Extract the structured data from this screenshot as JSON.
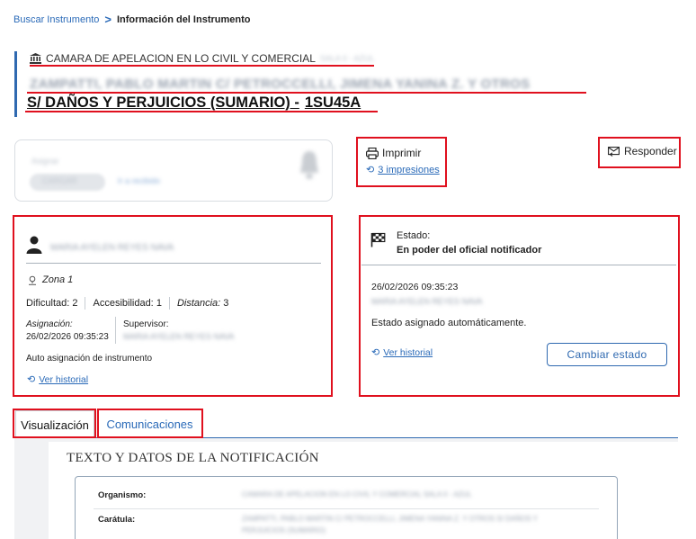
{
  "breadcrumb": {
    "link": "Buscar Instrumento",
    "separator": ">",
    "current": "Información del Instrumento"
  },
  "header": {
    "court": "CAMARA DE APELACION EN LO CIVIL Y COMERCIAL",
    "court_suffix_redacted": "SALA II - AZUL",
    "parties_redacted": "ZAMPATTI, PABLO MARTIN C/ PETROCCELLI, JIMENA YANINA Z. Y OTROS",
    "caption": "S/ DAÑOS Y PERJUICIOS (SUMARIO) -",
    "case_number": "1SU45A"
  },
  "blurred_card": {
    "label": "Asignar",
    "pill": "CARGAR",
    "link": "Ir a recibido"
  },
  "print": {
    "label": "Imprimir",
    "prints_link": "3 impresiones"
  },
  "reply": {
    "label": "Responder"
  },
  "assignment": {
    "person_redacted": "MARIA AYELEN REYES NAVA",
    "zone": "Zona 1",
    "difficulty_label": "Dificultad:",
    "difficulty": "2",
    "accessibility_label": "Accesibilidad:",
    "accessibility": "1",
    "distance_label": "Distancia:",
    "distance": "3",
    "assigned_label": "Asignación:",
    "assigned_date": "26/02/2026 09:35:23",
    "supervisor_label": "Supervisor:",
    "supervisor_redacted": "MARIA AYELEN REYES NAVA",
    "auto_note": "Auto asignación de instrumento",
    "history_link": "Ver historial"
  },
  "status": {
    "label": "Estado:",
    "value": "En poder del oficial notificador",
    "date": "26/02/2026 09:35:23",
    "user_redacted": "MARIA AYELEN REYES NAVA",
    "note": "Estado asignado automáticamente.",
    "history_link": "Ver historial",
    "change_button": "Cambiar estado"
  },
  "tabs": [
    {
      "label": "Visualización",
      "active": true
    },
    {
      "label": "Comunicaciones",
      "active": false
    }
  ],
  "notification": {
    "title": "TEXTO Y DATOS DE LA NOTIFICACIÓN",
    "organismo_label": "Organismo:",
    "organismo_redacted": "CAMARA DE APELACION EN LO CIVIL Y COMERCIAL SALA II - AZUL",
    "caratula_label": "Carátula:",
    "caratula_redacted_1": "ZAMPATTI, PABLO MARTIN C/ PETROCCELLI, JIMENA YANINA Z. Y OTROS S/ DAÑOS Y",
    "caratula_redacted_2": "PERJUICIOS (SUMARIO)"
  },
  "colors": {
    "accent": "#2f69b0",
    "link": "#2a6ab8",
    "highlight": "#e0101e",
    "content_bg": "#f1f2f4"
  },
  "icons": {
    "court": "bank-building-icon",
    "print": "printer-icon",
    "history": "history-clock-icon",
    "reply": "reply-envelope-icon",
    "person": "person-icon",
    "location": "map-pin-icon",
    "status": "checkered-flag-icon",
    "notification": "bell-icon"
  }
}
